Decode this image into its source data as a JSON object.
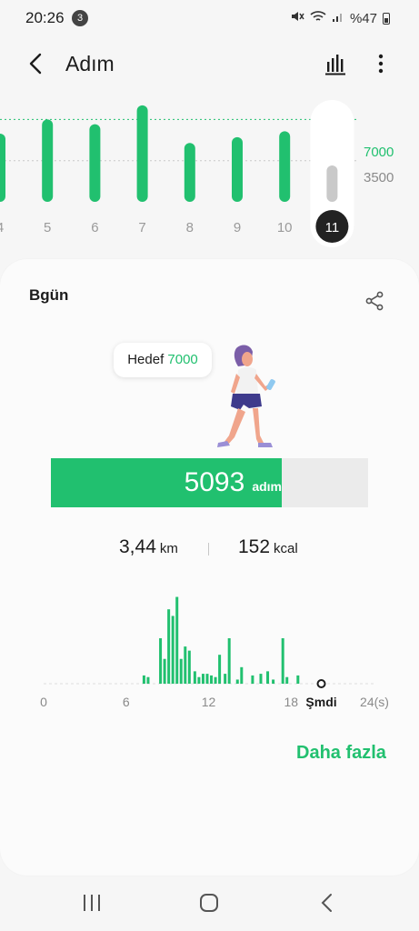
{
  "status": {
    "time": "20:26",
    "notifications": "3",
    "battery": "%47"
  },
  "header": {
    "title": "Adım"
  },
  "week": {
    "days": [
      "4",
      "5",
      "6",
      "7",
      "8",
      "9",
      "10",
      "11"
    ],
    "values": [
      5800,
      7000,
      6600,
      8200,
      5000,
      5500,
      6000,
      5093
    ],
    "selected": "11",
    "goal_label": "7000",
    "half_label": "3500",
    "goal": 7000,
    "half": 3500
  },
  "today": {
    "title": "Bgün",
    "goal_text": "Hedef",
    "goal_value": "7000",
    "steps": "5093",
    "steps_unit": "adım",
    "progress": 0.7276,
    "distance": "3,44",
    "distance_unit": "km",
    "calories": "152",
    "calories_unit": "kcal"
  },
  "chart_data": {
    "type": "bar",
    "x_ticks": [
      "0",
      "6",
      "12",
      "18",
      "Şmdi",
      "24(s)"
    ],
    "hours": [
      7.3,
      7.6,
      8.5,
      8.8,
      9.1,
      9.4,
      9.7,
      10.0,
      10.3,
      10.6,
      11.0,
      11.3,
      11.6,
      11.9,
      12.2,
      12.5,
      12.8,
      13.2,
      13.5,
      14.1,
      14.4,
      15.2,
      15.8,
      16.3,
      16.7,
      17.4,
      17.7,
      18.5
    ],
    "values": [
      10,
      8,
      55,
      30,
      90,
      82,
      105,
      30,
      45,
      40,
      15,
      8,
      12,
      12,
      10,
      8,
      35,
      12,
      55,
      5,
      20,
      10,
      12,
      15,
      5,
      55,
      8,
      10
    ],
    "ylim": [
      0,
      110
    ],
    "xlim": [
      0,
      24
    ],
    "now_hour": 20.2
  },
  "more_label": "Daha fazla",
  "colors": {
    "accent": "#21c06f",
    "selected": "#222222"
  }
}
